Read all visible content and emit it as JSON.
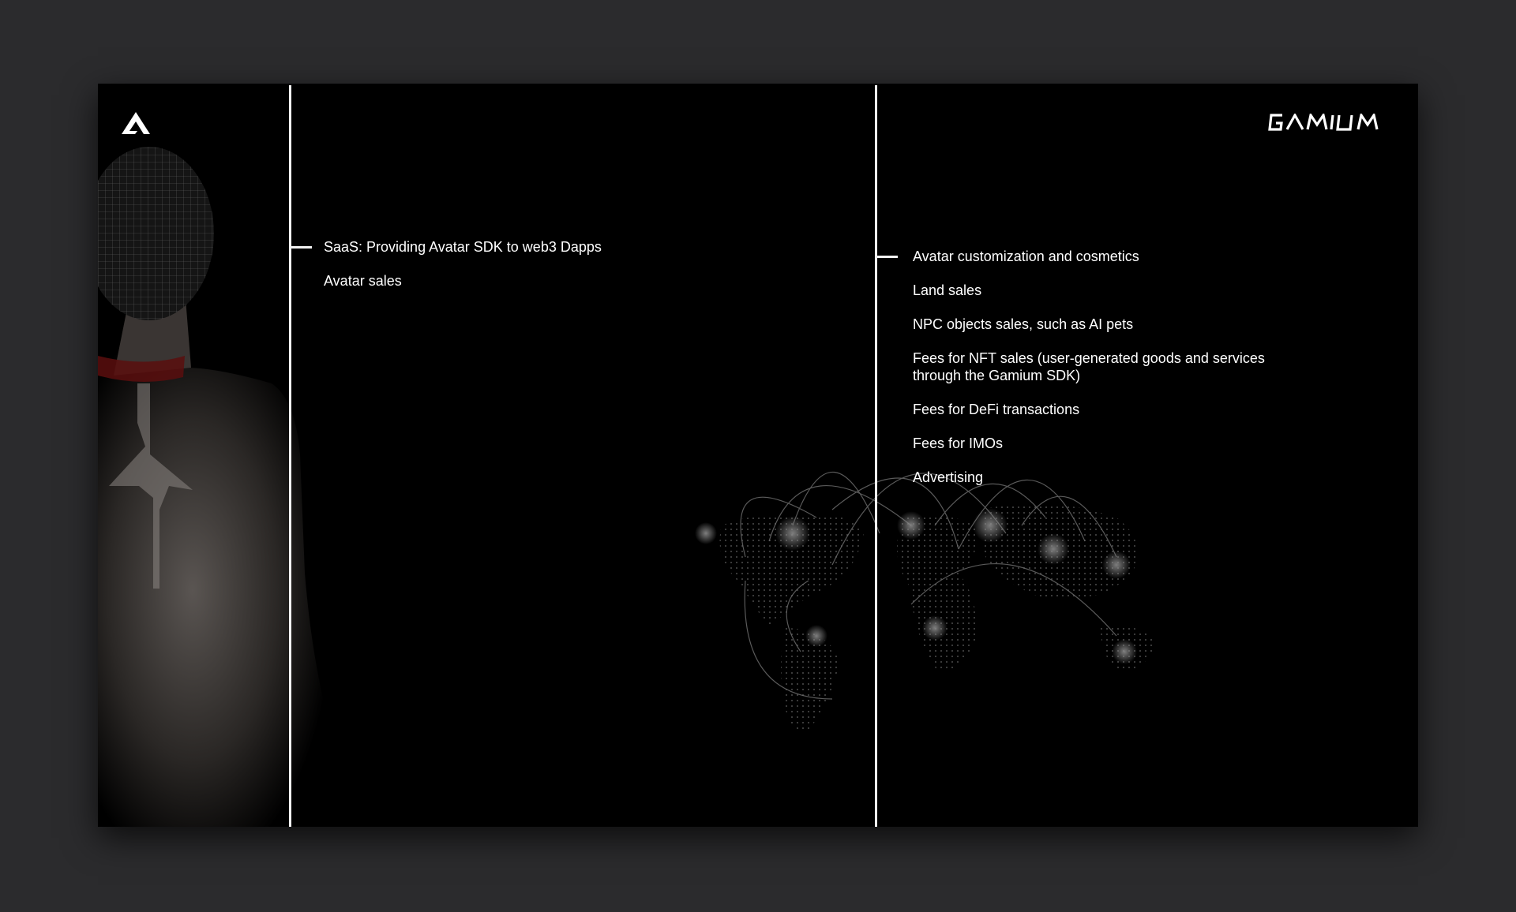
{
  "slide": {
    "left_column": {
      "items": [
        "SaaS: Providing Avatar SDK to web3 Dapps",
        "Avatar sales"
      ]
    },
    "right_column": {
      "items": [
        "Avatar customization and cosmetics",
        "Land sales",
        "NPC objects sales, such as AI pets",
        "Fees for NFT sales (user-generated goods and services\nthrough the Gamium SDK)",
        "Fees for DeFi transactions",
        "Fees for IMOs",
        "Advertising"
      ]
    },
    "brand": {
      "logo_icon": "gamium-a-logo-icon",
      "wordmark": "GAMIUM"
    },
    "colors": {
      "background": "#000000",
      "frame": "#2b2b2d",
      "text": "#ffffff",
      "accent_red": "#7a0f0f"
    }
  }
}
